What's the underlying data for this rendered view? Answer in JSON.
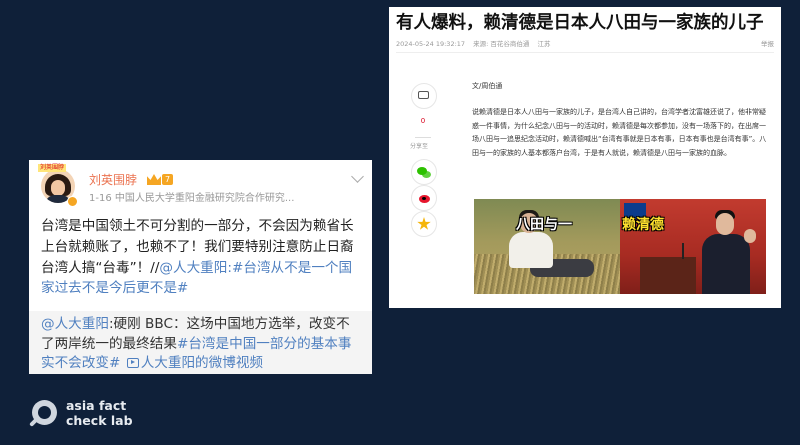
{
  "weibo_post": {
    "avatar_tag": "刘英围脖",
    "username": "刘英围脖",
    "level": "7",
    "meta": "1-16  中国人民大学重阳金融研究院合作研究...",
    "text_before": "台湾是中国领土不可分割的一部分，不会因为赖省长上台就赖账了，也赖不了！我们要特别注意防止日裔台湾人搞“台毒”！//",
    "mention": "@人大重阳",
    "hashtag": ":#台湾从不是一个国家过去不是今后更不是#",
    "quote_mention": "@人大重阳",
    "quote_text": ":硬刚 BBC：这场中国地方选举，改变不了两岸统一的最终结果",
    "quote_hashtag": "#台湾是中国一部分的基本事实不会改变#",
    "quote_video": "人大重阳的微博视频"
  },
  "article": {
    "title": "有人爆料，赖清德是日本人八田与一家族的儿子",
    "date": "2024-05-24 19:32:17",
    "source": "来源: 百花谷商伯通",
    "location": "江苏",
    "report": "举报",
    "comment_count": "0",
    "share_label": "分享至",
    "author": "文/周伯通",
    "body": "说赖清德是日本人八田与一家族的儿子，是台湾人自己讲的，台湾学者沈富雄还说了，他非常疑惑一件事情，为什么纪念八田与一的活动时，赖清德是每次都参加，没有一场落下的，在出席一场八田与一追思纪念活动时，赖清德喊出“台湾有事就是日本有事，日本有事也是台湾有事”。八田与一的家族的人基本都落户台湾，于是有人就说，赖清德是八田与一家族的血脉。",
    "image_caption_left": "八田与一",
    "image_caption_right": "赖清德"
  },
  "logo": {
    "line1": "asia fact",
    "line2": "check lab"
  },
  "colors": {
    "background": "#0f2039",
    "weibo_name": "#eb7350",
    "link": "#5080c0"
  }
}
